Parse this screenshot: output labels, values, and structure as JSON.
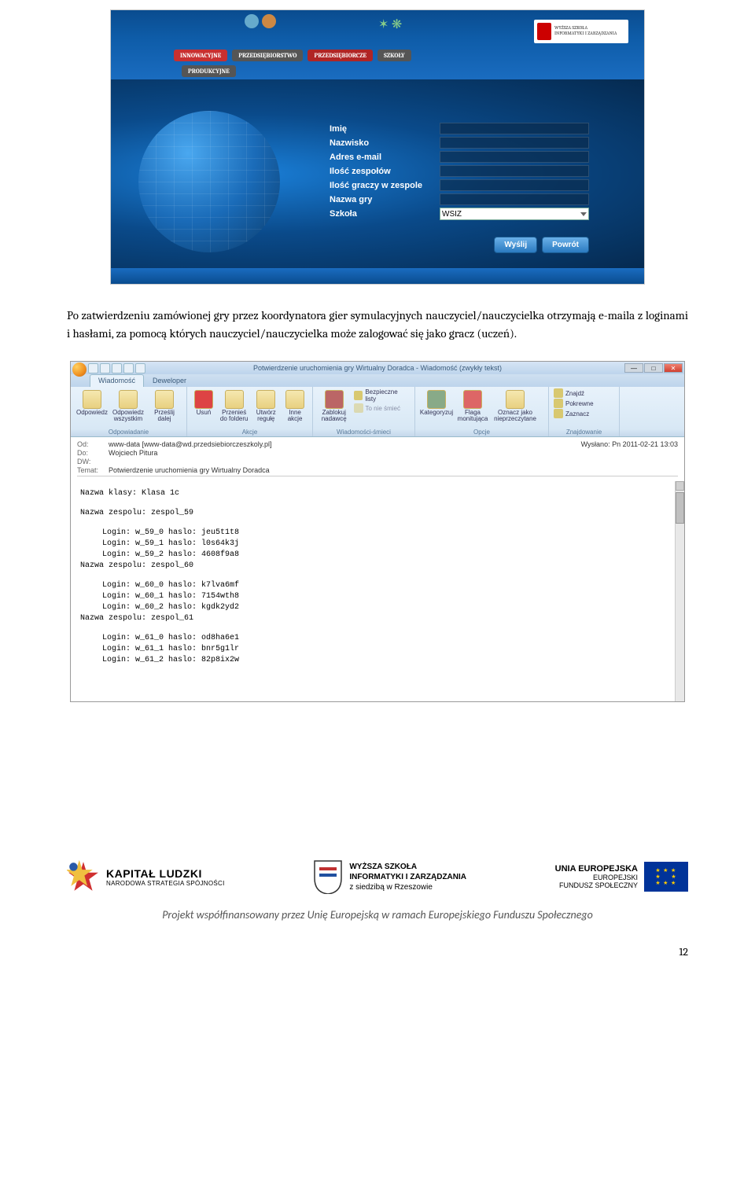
{
  "screenshot1": {
    "banner": {
      "pill1": "INNOWACYJNE",
      "pill2": "PRZEDSIĘBIORSTWO",
      "pill3": "PRZEDSIĘBIORCZE",
      "pill4": "SZKOŁY",
      "pill5": "PRODUKCYJNE"
    },
    "school_logo": {
      "l1": "WYŻSZA SZKOŁA",
      "l2": "INFORMATYKI I ZARZĄDZANIA"
    },
    "form": {
      "rows": [
        {
          "label": "Imię"
        },
        {
          "label": "Nazwisko"
        },
        {
          "label": "Adres e-mail"
        },
        {
          "label": "Ilość zespołów"
        },
        {
          "label": "Ilość graczy w zespole"
        },
        {
          "label": "Nazwa gry"
        }
      ],
      "select_label": "Szkoła",
      "select_value": "WSIZ",
      "btn_submit": "Wyślij",
      "btn_back": "Powrót"
    }
  },
  "paragraph": "Po zatwierdzeniu zamówionej gry przez koordynatora gier symulacyjnych nauczyciel/nauczycielka otrzymają e-maila z loginami i hasłami, za pomocą których nauczyciel/nauczycielka może zalogować się jako gracz (uczeń).",
  "screenshot2": {
    "window_title": "Potwierdzenie uruchomienia gry Wirtualny Doradca - Wiadomość (zwykły tekst)",
    "tabs": {
      "t1": "Wiadomość",
      "t2": "Deweloper"
    },
    "ribbon": {
      "g1": {
        "label": "Odpowiadanie",
        "b1": "Odpowiedz",
        "b2": "Odpowiedz wszystkim",
        "b3": "Prześlij dalej"
      },
      "g2": {
        "label": "Akcje",
        "b1": "Usuń",
        "b2": "Przenieś do folderu",
        "b3": "Utwórz regułę",
        "b4": "Inne akcje"
      },
      "g3": {
        "label": "Wiadomości-śmieci",
        "b1": "Zablokuj nadawcę",
        "b2": "Bezpieczne listy",
        "b3": "To nie śmieć"
      },
      "g4": {
        "label": "Opcje",
        "b1": "Kategoryzuj",
        "b2": "Flaga monitująca",
        "b3": "Oznacz jako nieprzeczytane"
      },
      "g5": {
        "label": "Znajdowanie",
        "b1": "Znajdź",
        "b2": "Pokrewne",
        "b3": "Zaznacz"
      }
    },
    "headers": {
      "from_lbl": "Od:",
      "from_val": "www-data [www-data@wd.przedsiebiorczeszkoly.pl]",
      "to_lbl": "Do:",
      "to_val": "Wojciech Pitura",
      "cc_lbl": "DW:",
      "subj_lbl": "Temat:",
      "subj_val": "Potwierdzenie uruchomienia gry Wirtualny Doradca",
      "sent_lbl": "Wysłano:",
      "sent_val": "Pn 2011-02-21 13:03"
    },
    "body": {
      "klasa": "Nazwa klasy: Klasa 1c",
      "teams": [
        {
          "name": "Nazwa zespolu: zespol_59",
          "logins": [
            "Login: w_59_0 haslo: jeu5t1t8",
            "Login: w_59_1 haslo: l0s64k3j",
            "Login: w_59_2 haslo: 4608f9a8"
          ]
        },
        {
          "name": "Nazwa zespolu: zespol_60",
          "logins": [
            "Login: w_60_0 haslo: k7lva6mf",
            "Login: w_60_1 haslo: 7154wth8",
            "Login: w_60_2 haslo: kgdk2yd2"
          ]
        },
        {
          "name": "Nazwa zespolu: zespol_61",
          "logins": [
            "Login: w_61_0 haslo: od8ha6e1",
            "Login: w_61_1 haslo: bnr5g1lr",
            "Login: w_61_2 haslo: 82p8ix2w"
          ]
        }
      ]
    }
  },
  "footer": {
    "kl": {
      "t1": "KAPITAŁ LUDZKI",
      "t2": "NARODOWA STRATEGIA SPÓJNOŚCI"
    },
    "wsiz": {
      "t1": "WYŻSZA SZKOŁA",
      "t2": "INFORMATYKI I ZARZĄDZANIA",
      "t3": "z siedzibą w Rzeszowie"
    },
    "ue": {
      "t1": "UNIA EUROPEJSKA",
      "t2": "EUROPEJSKI",
      "t3": "FUNDUSZ SPOŁECZNY"
    },
    "line": "Projekt współfinansowany przez Unię Europejską w ramach Europejskiego Funduszu Społecznego",
    "page": "12"
  }
}
